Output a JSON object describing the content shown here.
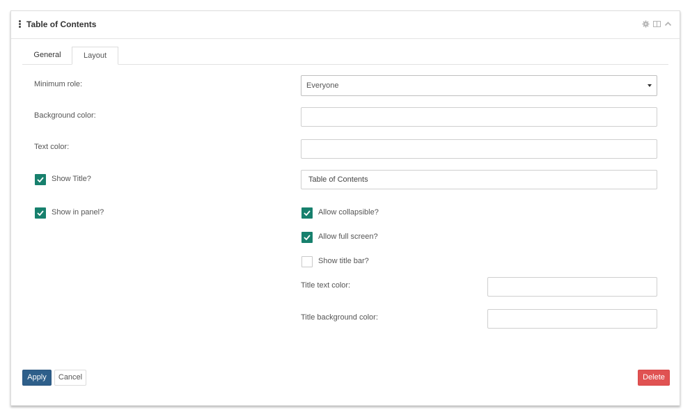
{
  "panel": {
    "title": "Table of Contents"
  },
  "header_icons": {
    "settings": "gear-icon",
    "layout": "columns-icon",
    "collapse": "chevron-up-icon"
  },
  "tabs": [
    {
      "label": "General",
      "active": false
    },
    {
      "label": "Layout",
      "active": true
    }
  ],
  "form": {
    "minimum_role": {
      "label": "Minimum role:",
      "value": "Everyone"
    },
    "background_color": {
      "label": "Background color:",
      "value": ""
    },
    "text_color": {
      "label": "Text color:",
      "value": ""
    },
    "show_title": {
      "label": "Show Title?",
      "checked": true,
      "title_value": "Table of Contents"
    },
    "show_in_panel": {
      "label": "Show in panel?",
      "checked": true
    },
    "allow_collapsible": {
      "label": "Allow collapsible?",
      "checked": true
    },
    "allow_full_screen": {
      "label": "Allow full screen?",
      "checked": true
    },
    "show_title_bar": {
      "label": "Show title bar?",
      "checked": false
    },
    "title_text_color": {
      "label": "Title text color:",
      "value": ""
    },
    "title_background_color": {
      "label": "Title background color:",
      "value": ""
    }
  },
  "buttons": {
    "apply": "Apply",
    "cancel": "Cancel",
    "delete": "Delete"
  },
  "colors": {
    "checkbox_on": "#17806d",
    "apply_bg": "#2e5f8a",
    "delete_bg": "#e05252"
  }
}
